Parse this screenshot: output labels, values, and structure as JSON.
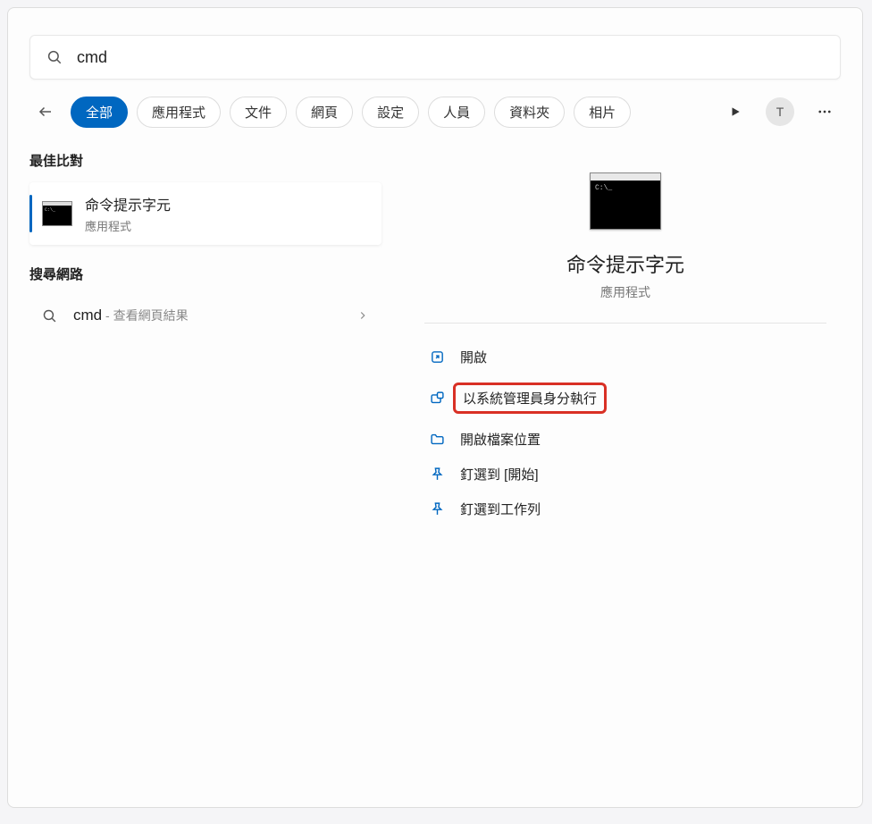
{
  "search": {
    "query": "cmd"
  },
  "filters": {
    "active": "全部",
    "items": [
      "全部",
      "應用程式",
      "文件",
      "網頁",
      "設定",
      "人員",
      "資料夾",
      "相片"
    ]
  },
  "avatar_letter": "T",
  "left": {
    "best_match_header": "最佳比對",
    "best_match": {
      "title": "命令提示字元",
      "subtitle": "應用程式"
    },
    "web_header": "搜尋網路",
    "web": {
      "term": "cmd",
      "hint": " - 查看網頁結果"
    }
  },
  "detail": {
    "title": "命令提示字元",
    "subtitle": "應用程式",
    "actions": {
      "open": "開啟",
      "run_as_admin": "以系統管理員身分執行",
      "open_location": "開啟檔案位置",
      "pin_start": "釘選到 [開始]",
      "pin_taskbar": "釘選到工作列"
    }
  }
}
